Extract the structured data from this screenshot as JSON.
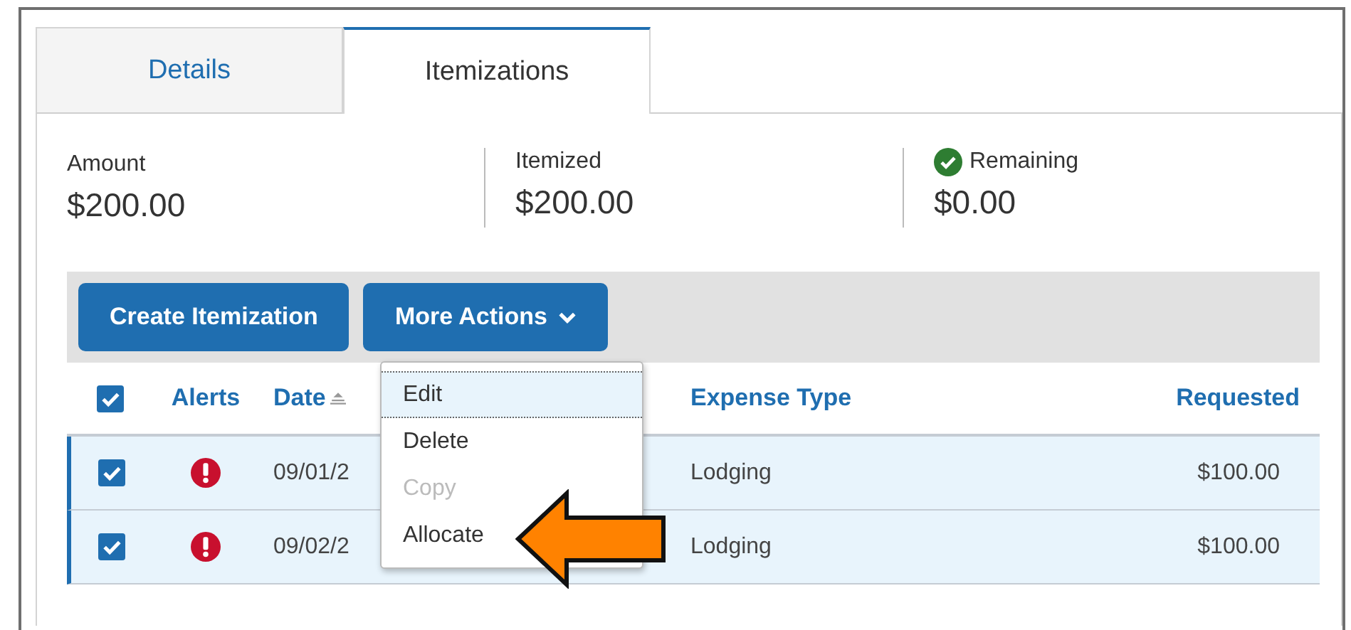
{
  "tabs": [
    {
      "label": "Details",
      "selected": false
    },
    {
      "label": "Itemizations",
      "selected": true
    }
  ],
  "summary": [
    {
      "label": "Amount",
      "value": "$200.00",
      "ok": false
    },
    {
      "label": "Itemized",
      "value": "$200.00",
      "ok": false
    },
    {
      "label": "Remaining",
      "value": "$0.00",
      "ok": true
    }
  ],
  "toolbar": {
    "create_button": "Create Itemization",
    "more_button": "More Actions"
  },
  "table": {
    "all_checked": true,
    "columns": [
      "Alerts",
      "Date",
      "Expense Type",
      "Requested"
    ],
    "rows": [
      {
        "checked": true,
        "selected": true,
        "alert": true,
        "date": "09/01/2",
        "expense_type": "Lodging",
        "requested": "$100.00"
      },
      {
        "checked": true,
        "selected": true,
        "alert": true,
        "date": "09/02/2",
        "expense_type": "Lodging",
        "requested": "$100.00"
      }
    ]
  },
  "menu": [
    {
      "label": "Edit",
      "selected": true,
      "disabled": false
    },
    {
      "label": "Delete",
      "selected": false,
      "disabled": false
    },
    {
      "label": "Copy",
      "selected": false,
      "disabled": true
    },
    {
      "label": "Allocate",
      "selected": false,
      "disabled": false
    }
  ]
}
